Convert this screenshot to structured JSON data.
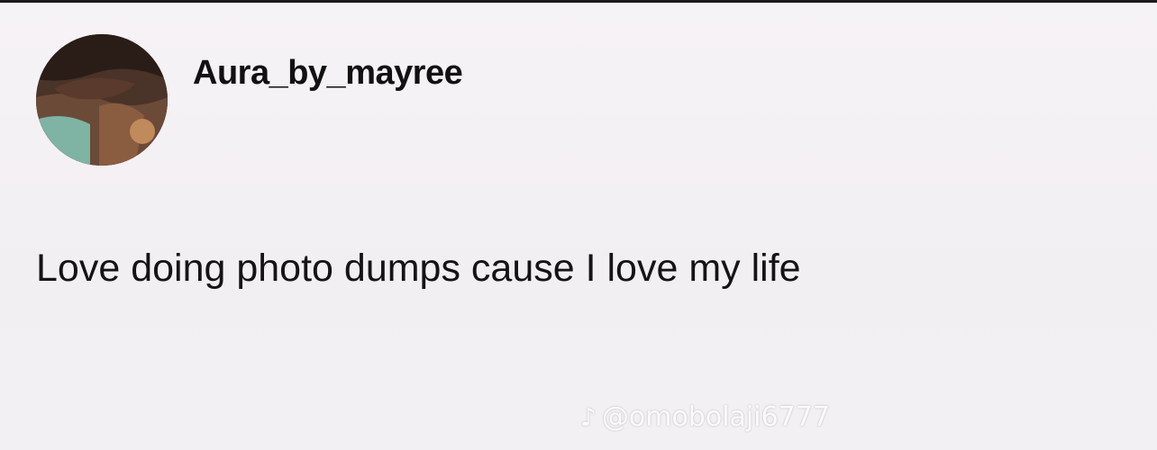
{
  "post": {
    "username": "Aura_by_mayree",
    "text": "Love doing photo dumps cause I love my life"
  },
  "watermark": {
    "icon": "tiktok-note-icon",
    "text": "@omobolaji6777"
  },
  "colors": {
    "background": "#f4f1f4",
    "text": "#141414"
  }
}
